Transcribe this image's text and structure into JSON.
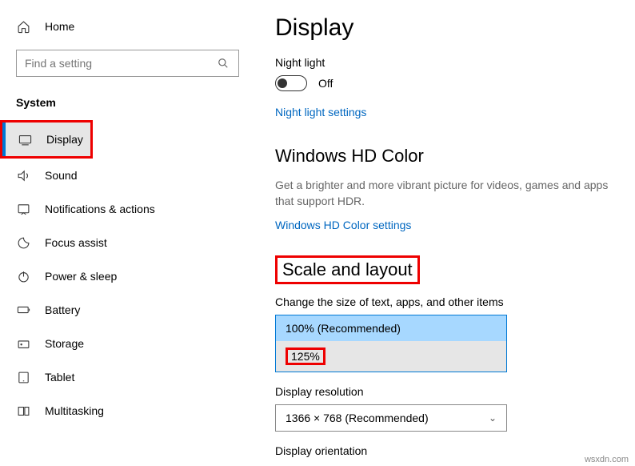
{
  "sidebar": {
    "home": "Home",
    "search_placeholder": "Find a setting",
    "section": "System",
    "items": [
      {
        "label": "Display",
        "active": true
      },
      {
        "label": "Sound"
      },
      {
        "label": "Notifications & actions"
      },
      {
        "label": "Focus assist"
      },
      {
        "label": "Power & sleep"
      },
      {
        "label": "Battery"
      },
      {
        "label": "Storage"
      },
      {
        "label": "Tablet"
      },
      {
        "label": "Multitasking"
      }
    ]
  },
  "main": {
    "title": "Display",
    "nightlight_label": "Night light",
    "nightlight_state": "Off",
    "nightlight_link": "Night light settings",
    "hdcolor_title": "Windows HD Color",
    "hdcolor_desc": "Get a brighter and more vibrant picture for videos, games and apps that support HDR.",
    "hdcolor_link": "Windows HD Color settings",
    "scale_title": "Scale and layout",
    "scale_label": "Change the size of text, apps, and other items",
    "scale_options": [
      "100% (Recommended)",
      "125%"
    ],
    "resolution_label": "Display resolution",
    "resolution_value": "1366 × 768 (Recommended)",
    "orientation_label": "Display orientation"
  },
  "watermark": "wsxdn.com"
}
